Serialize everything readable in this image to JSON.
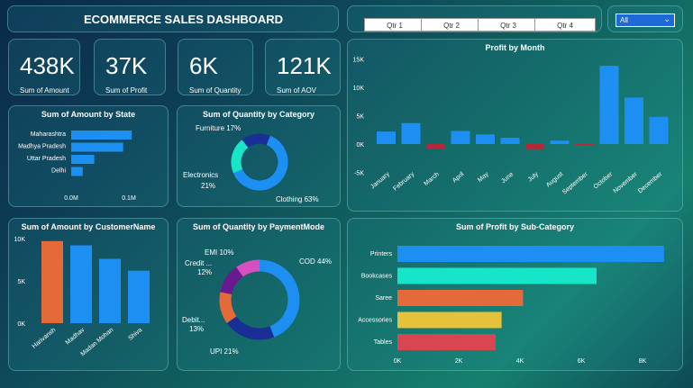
{
  "header": {
    "title": "ECOMMERCE SALES DASHBOARD"
  },
  "quarters": [
    "Qtr 1",
    "Qtr 2",
    "Qtr 3",
    "Qtr 4"
  ],
  "dropdown": {
    "value": "All"
  },
  "kpis": [
    {
      "value": "438K",
      "label": "Sum of Amount"
    },
    {
      "value": "37K",
      "label": "Sum of Profit"
    },
    {
      "value": "6K",
      "label": "Sum of Quantity"
    },
    {
      "value": "121K",
      "label": "Sum of AOV"
    }
  ],
  "colors": {
    "blue": "#1e8ff2",
    "orange": "#e56a3a",
    "teal": "#16e6c7",
    "yellow": "#e6c23a",
    "red": "#d94652",
    "navy": "#1a2f96",
    "purple": "#6a1a8f",
    "magenta": "#d64fc0",
    "darkred": "#b22a3a"
  },
  "chart_data": [
    {
      "type": "bar",
      "id": "amount_by_state",
      "title": "Sum of Amount by State",
      "categories": [
        "Maharashtra",
        "Madhya Pradesh",
        "Uttar Pradesh",
        "Delhi"
      ],
      "values": [
        0.105,
        0.09,
        0.04,
        0.02
      ],
      "xticks": [
        "0.0M",
        "0.1M"
      ],
      "xlim": [
        0,
        0.14
      ]
    },
    {
      "type": "pie",
      "id": "quantity_by_category",
      "title": "Sum of Quantity by Category",
      "slices": [
        {
          "label": "Clothing 63%",
          "value": 63
        },
        {
          "label": "Electronics 21%",
          "value": 21
        },
        {
          "label": "Furniture 17%",
          "value": 17
        }
      ]
    },
    {
      "type": "bar",
      "id": "profit_by_month",
      "title": "Profit by Month",
      "categories": [
        "January",
        "February",
        "March",
        "April",
        "May",
        "June",
        "July",
        "August",
        "September",
        "October",
        "November",
        "December"
      ],
      "values": [
        2200,
        3700,
        -800,
        2300,
        1700,
        1100,
        -1000,
        600,
        -150,
        13800,
        8200,
        4800
      ],
      "yticks": [
        "15K",
        "10K",
        "5K",
        "0K",
        "-5K"
      ],
      "ylim": [
        -5000,
        15000
      ]
    },
    {
      "type": "bar",
      "id": "amount_by_customer",
      "title": "Sum of Amount by CustomerName",
      "categories": [
        "Harivansh",
        "Madhav",
        "Madan Mohan",
        "Shiva"
      ],
      "values": [
        9700,
        9200,
        7600,
        6200
      ],
      "yticks": [
        "10K",
        "5K",
        "0K"
      ],
      "ylim": [
        0,
        10000
      ]
    },
    {
      "type": "pie",
      "id": "quantity_by_paymentmode",
      "title": "Sum of Quantity by PaymentMode",
      "slices": [
        {
          "label": "COD 44%",
          "value": 44
        },
        {
          "label": "UPI 21%",
          "value": 21
        },
        {
          "label": "Debit... 13%",
          "value": 13
        },
        {
          "label": "Credit ... 12%",
          "value": 12
        },
        {
          "label": "EMI 10%",
          "value": 10
        }
      ]
    },
    {
      "type": "bar",
      "id": "profit_by_subcategory",
      "title": "Sum of Profit by Sub-Category",
      "categories": [
        "Printers",
        "Bookcases",
        "Saree",
        "Accessories",
        "Tables"
      ],
      "values": [
        8700,
        6500,
        4100,
        3400,
        3200
      ],
      "xticks": [
        "0K",
        "2K",
        "4K",
        "6K",
        "8K"
      ],
      "xlim": [
        0,
        9000
      ]
    }
  ]
}
